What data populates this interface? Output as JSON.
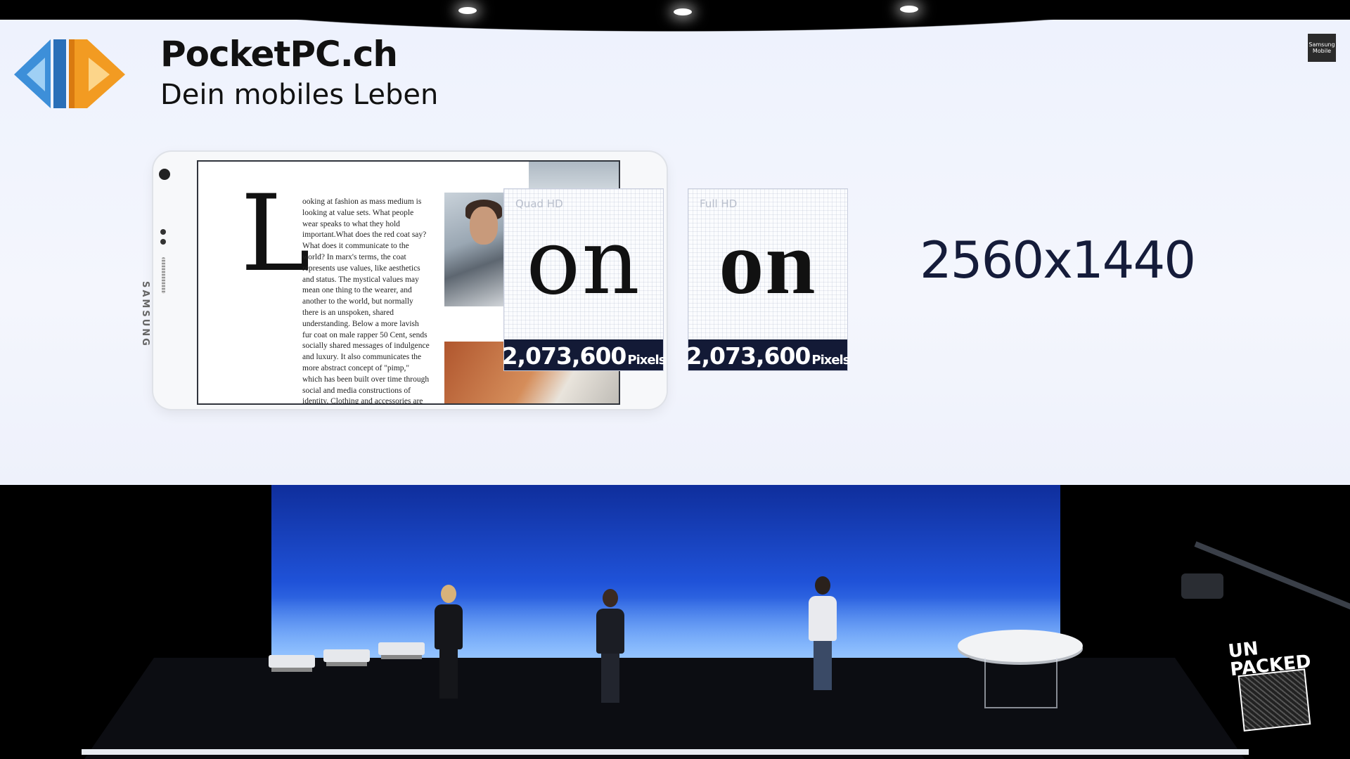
{
  "logo": {
    "icon": "pocketpc-logo-icon",
    "name": "PocketPC.ch",
    "tagline": "Dein mobiles Leben",
    "colors": {
      "blue": "#3d8fd9",
      "orange": "#f29b22"
    }
  },
  "corner_badge": {
    "line1": "Samsung",
    "line2": "Mobile"
  },
  "phone": {
    "brand": "SAMSUNG",
    "article": {
      "dropcap": "L",
      "text": "ooking at fashion as mass medium is looking at value sets. What people wear speaks to what they hold important.What does the red coat say? What does it communicate to the world? In marx's terms, the coat represents use values, like aesthetics and status. The mystical values may mean one thing to the wearer, and another to the world, but normally there is an unspoken, shared understanding. Below a more lavish fur coat on male rapper 50 Cent, sends socially shared messages of indulgence and luxury. It also communicates the more abstract concept of \"pimp,\" which has been built over time through social and media constructions of identity. Clothing and accessories are signs. They represent values and we understand the connotations. We do not have to discuss a crown to understand"
    }
  },
  "comparison": [
    {
      "label": "Quad HD",
      "word": "on",
      "pixels": "2,073,600",
      "unit": "Pixels"
    },
    {
      "label": "Full HD",
      "word": "on",
      "pixels": "2,073,600",
      "unit": "Pixels"
    }
  ],
  "resolution": "2560x1440",
  "event_logo": {
    "line1": "UN",
    "line2": "PACKED"
  },
  "colors": {
    "screen_bg": "#f1f4fd",
    "pixel_bar": "#131a36",
    "backdrop_blue": "#1f52d8"
  }
}
